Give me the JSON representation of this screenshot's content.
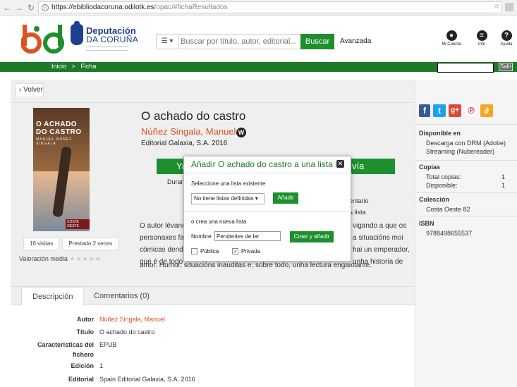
{
  "browser": {
    "url_domain": "https://ebibliodacoruna.odilotk.es",
    "url_path": "/opac/#fichaResultados"
  },
  "header": {
    "dep_line1": "Deputación",
    "dep_line2": "DA CORUÑA",
    "search_placeholder": "Buscar por título, autor, editorial...",
    "search_button": "Buscar",
    "advanced_link": "Avanzada",
    "account_label": "Mi Cuenta",
    "info_label": "Info",
    "help_label": "Ayuda"
  },
  "breadcrumb": {
    "home": "Inicio",
    "separator": ">",
    "current": "Ficha",
    "logout": "Salir"
  },
  "back_label": "Volver",
  "cover": {
    "title_line1": "O ACHADO",
    "title_line2": "DO CASTRO",
    "author": "MANUEL NÚÑEZ SINGALA",
    "publisher": "COSTA OESTE"
  },
  "stats": {
    "visits": "16 visitas",
    "loans": "Prestado 2 veces",
    "rating_label": "Valoración media",
    "rating_stars": "★★★★★"
  },
  "book": {
    "title": "O achado do castro",
    "author": "Núñez Singala, Manuel",
    "author_badge": "W",
    "publisher": "Editorial Galaxia, S.A. 2016",
    "button_left_frag": "Ya",
    "button_right_frag": "vía",
    "duration_frag": "Duran",
    "comment_frag": "entario",
    "list_frag": "a lista",
    "syn_left_1": "O autor lévano",
    "syn_left_2": "personaxes fal",
    "syn_left_3": "cómicas dende",
    "syn_left_4": "que é de todo",
    "syn_right_1": "vigando a que os",
    "syn_right_2": "a situacións moi",
    "syn_right_3": "hai un emperador,",
    "syn_right_4": "unha historia de",
    "syn_bottom": "amor. Humor, situacións inauditas e, sobre todo, unha lectura engaiolante."
  },
  "tabs": [
    {
      "label": "Descripción"
    },
    {
      "label": "Comentarios (0)"
    }
  ],
  "details": {
    "author_label": "Autor",
    "author_value": "Núñez Singala, Manuel",
    "title_label": "Título",
    "title_value": "O achado do castro",
    "features_label_1": "Características del",
    "features_label_2": "fichero",
    "features_value": "EPUB",
    "edition_label": "Edición",
    "edition_value": "1",
    "publisher_label": "Editorial",
    "publisher_value": "Spain Editorial Galaxia, S.A. 2016"
  },
  "sidebar": {
    "available_head": "Disponible en",
    "available_1": "Descarga con DRM (Adobe)",
    "available_2": "Streaming (Nubereader)",
    "copies_head": "Copias",
    "total_label": "Total copias:",
    "total_value": "1",
    "available_label": "Disponible:",
    "available_value": "1",
    "collection_head": "Colección",
    "collection_value": "Costa Oeste 82",
    "isbn_head": "ISBN",
    "isbn_value": "9788498655537"
  },
  "modal": {
    "title": "Añadir O achado do castro a una lista",
    "select_existing_label": "Seleccione una lista existente",
    "select_value": "No tiene listas definidas",
    "add_button": "Añadir",
    "create_label": "o crea una nueva lista",
    "name_label": "Nombre:",
    "name_value": "Pendentes de ler",
    "create_button": "Crear y añadir",
    "public_label": "Pública",
    "private_label": "Privada"
  },
  "colors": {
    "green": "#1d8f2c",
    "dark_green": "#1d7a2a",
    "orange": "#e05020",
    "blue": "#1f3f8f"
  }
}
